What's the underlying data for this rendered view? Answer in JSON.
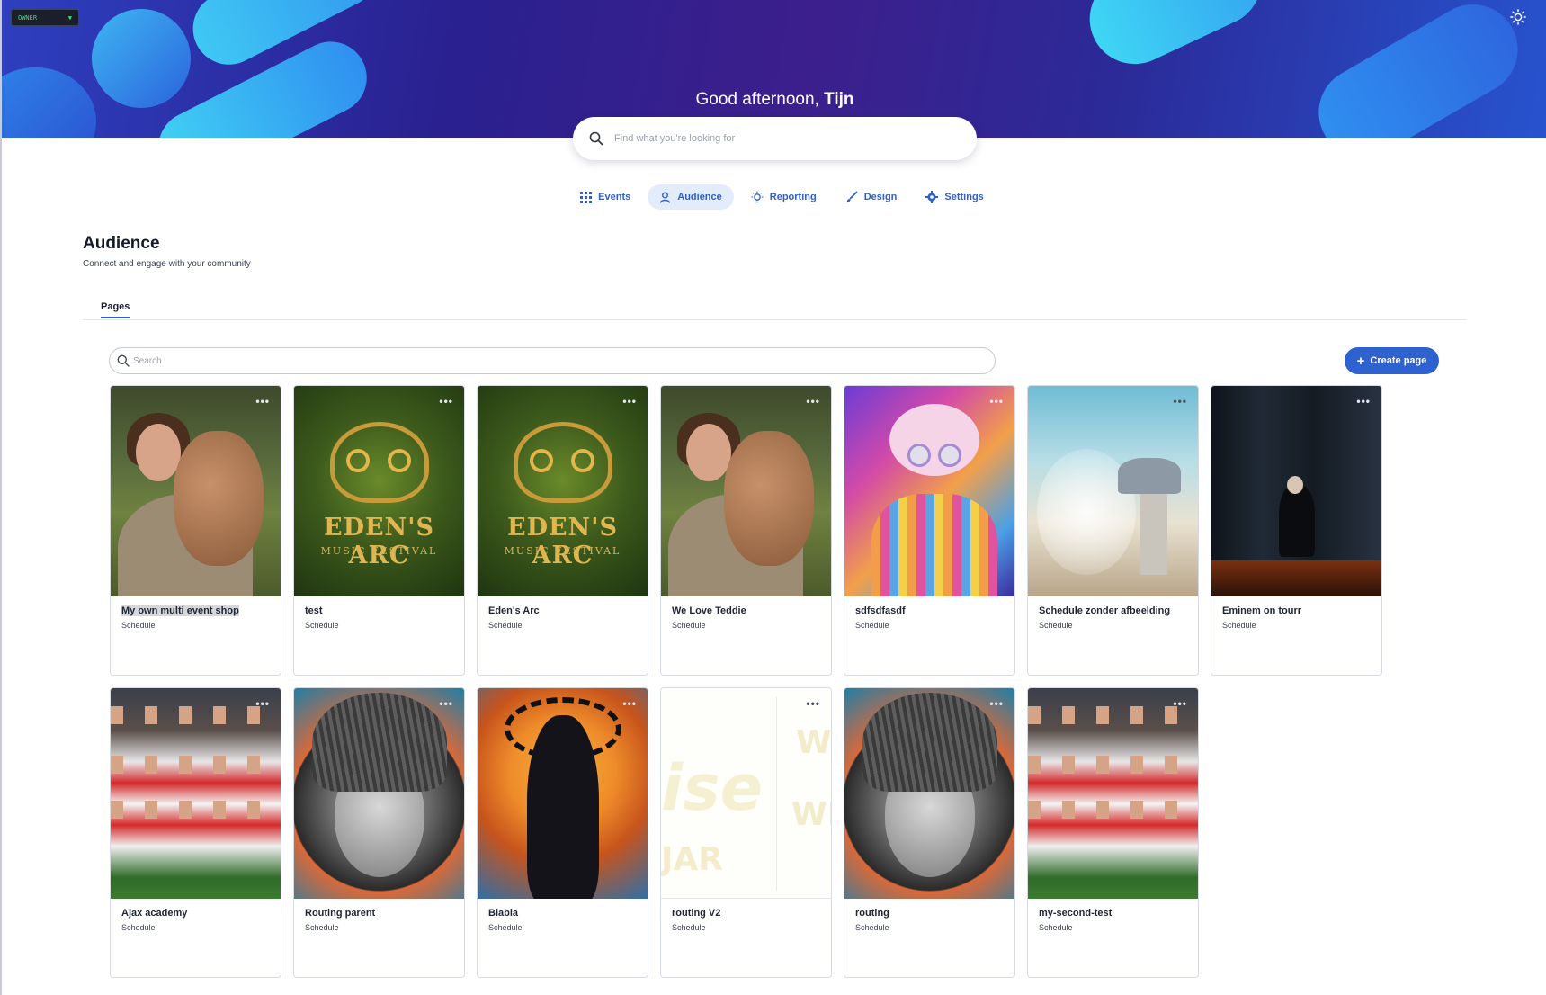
{
  "header": {
    "owner_badge": "OWNER",
    "greeting_prefix": "Good afternoon, ",
    "greeting_name": "Tijn",
    "search_placeholder": "Find what you're looking for"
  },
  "nav": {
    "items": [
      {
        "label": "Events",
        "icon": "grid-icon"
      },
      {
        "label": "Audience",
        "icon": "person-icon",
        "active": true
      },
      {
        "label": "Reporting",
        "icon": "lightbulb-icon"
      },
      {
        "label": "Design",
        "icon": "brush-icon"
      },
      {
        "label": "Settings",
        "icon": "gear-icon"
      }
    ]
  },
  "page": {
    "title": "Audience",
    "subtitle": "Connect and engage with your community",
    "tab": "Pages",
    "search_placeholder": "Search",
    "create_label": "Create page"
  },
  "cards": [
    {
      "title": "My own multi event shop",
      "subtitle": "Schedule"
    },
    {
      "title": "test",
      "subtitle": "Schedule"
    },
    {
      "title": "Eden's Arc",
      "subtitle": "Schedule"
    },
    {
      "title": "We Love Teddie",
      "subtitle": "Schedule"
    },
    {
      "title": "sdfsdfasdf",
      "subtitle": "Schedule"
    },
    {
      "title": "Schedule zonder afbeelding",
      "subtitle": "Schedule"
    },
    {
      "title": "Eminem on tourr",
      "subtitle": "Schedule"
    },
    {
      "title": "Ajax academy",
      "subtitle": "Schedule"
    },
    {
      "title": "Routing parent",
      "subtitle": "Schedule"
    },
    {
      "title": "Blabla",
      "subtitle": "Schedule"
    },
    {
      "title": "routing V2",
      "subtitle": "Schedule"
    },
    {
      "title": "routing",
      "subtitle": "Schedule"
    },
    {
      "title": "my-second-test",
      "subtitle": "Schedule"
    }
  ],
  "thumb_text": {
    "eden_main": "EDEN'S ARC",
    "eden_sub": "MUSIC FESTIVAL",
    "more_menu": "•••"
  },
  "colors": {
    "accent": "#2f62d1",
    "nav_text": "#2f5fc9",
    "owner_text": "#33e06c"
  }
}
